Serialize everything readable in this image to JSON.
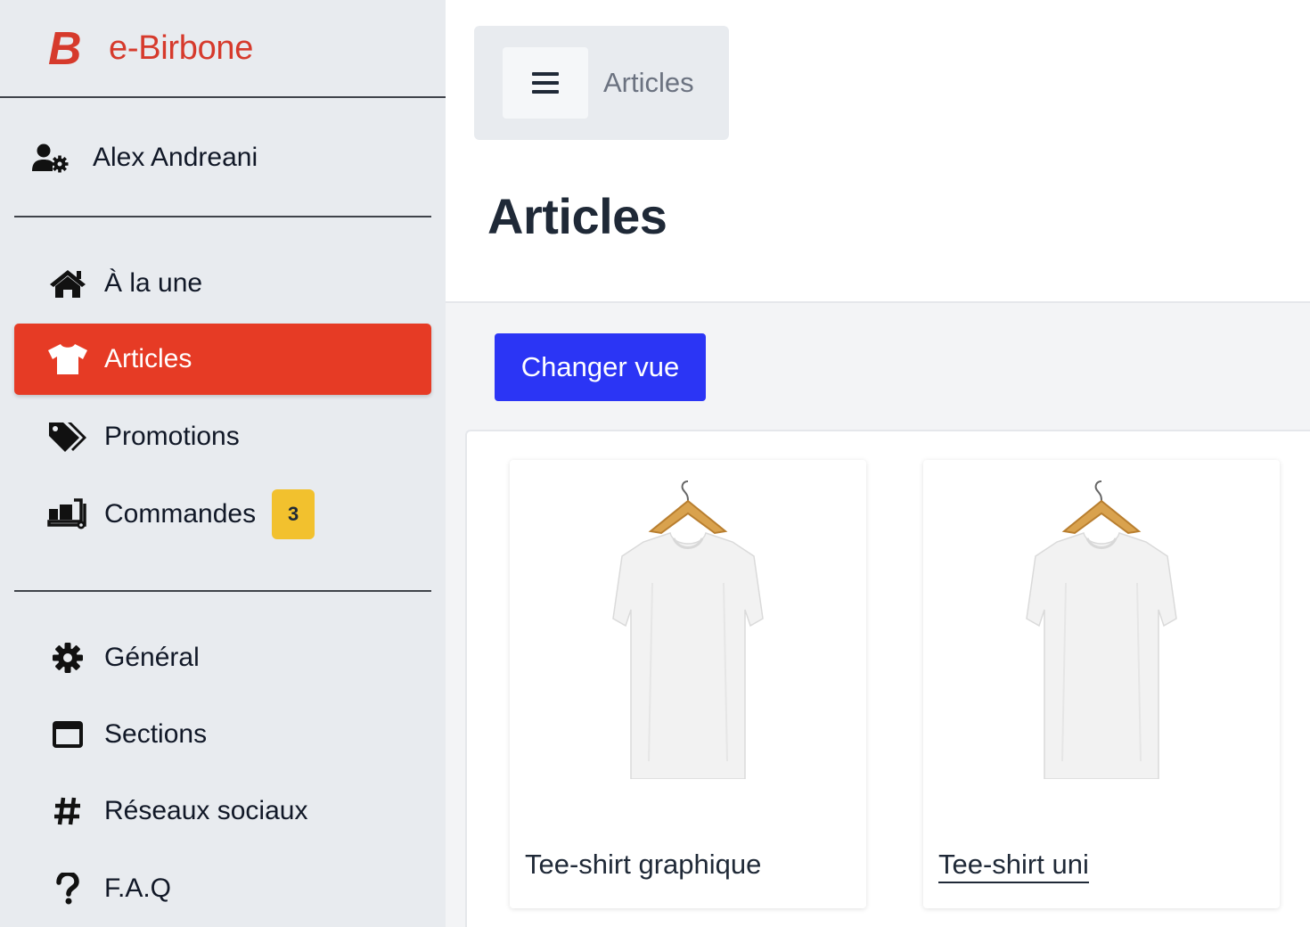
{
  "brand": {
    "name": "e-Birbone",
    "logo_letter": "B",
    "accent": "#e63b25"
  },
  "user": {
    "name": "Alex Andreani",
    "icon": "user-cog-icon"
  },
  "nav": {
    "primary": [
      {
        "label": "À la une",
        "icon": "home-icon",
        "active": false
      },
      {
        "label": "Articles",
        "icon": "tshirt-icon",
        "active": true
      },
      {
        "label": "Promotions",
        "icon": "tags-icon",
        "active": false
      },
      {
        "label": "Commandes",
        "icon": "dolly-icon",
        "active": false,
        "badge": "3"
      }
    ],
    "secondary": [
      {
        "label": "Général",
        "icon": "gear-icon"
      },
      {
        "label": "Sections",
        "icon": "window-icon"
      },
      {
        "label": "Réseaux sociaux",
        "icon": "hashtag-icon"
      },
      {
        "label": "F.A.Q",
        "icon": "question-icon"
      }
    ]
  },
  "header": {
    "breadcrumb": "Articles",
    "title": "Articles"
  },
  "toolbar": {
    "change_view_label": "Changer vue",
    "button_color": "#2b35f5"
  },
  "products": [
    {
      "name": "Tee-shirt graphique"
    },
    {
      "name": "Tee-shirt uni"
    }
  ]
}
